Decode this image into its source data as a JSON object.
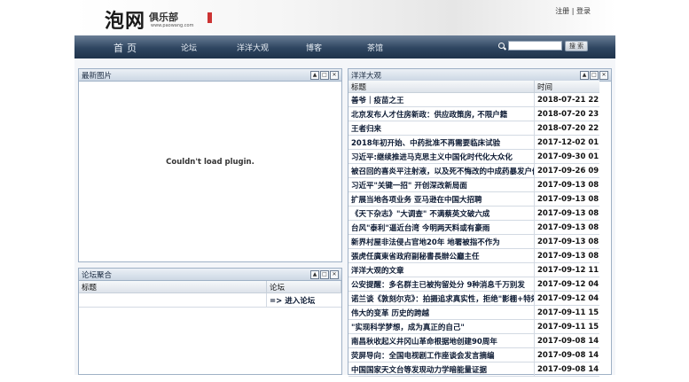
{
  "header": {
    "logo_main": "泡网",
    "logo_sub": "俱乐部",
    "logo_url": "www.paowang.com",
    "link_register": "注册",
    "link_sep": "|",
    "link_login": "登录"
  },
  "nav": {
    "items": [
      "首页",
      "论坛",
      "洋洋大观",
      "博客",
      "茶馆"
    ],
    "search_placeholder": "",
    "search_button": "搜 索"
  },
  "panels": {
    "latest_images": {
      "title": "最新图片",
      "plugin_message": "Couldn't load plugin."
    },
    "forum_aggregate": {
      "title": "论坛聚合",
      "col_title": "标题",
      "col_forum": "论坛",
      "link_enter": "=> 进入论坛"
    },
    "yangyang": {
      "title": "洋洋大观",
      "col_title": "标题",
      "col_time": "时间",
      "rows": [
        {
          "title": "善爷｜疫苗之王",
          "time": "2018-07-21 22:49"
        },
        {
          "title": "北京发布人才住房新政：供应政策房, 不限户籍",
          "time": "2018-07-20 23:13"
        },
        {
          "title": "王者归来",
          "time": "2018-07-20 22:59"
        },
        {
          "title": "2018年初开始、中药批准不再需要临床试验",
          "time": "2017-12-02 01:21"
        },
        {
          "title": "习近平:继续推进马克思主义中国化时代化大众化",
          "time": "2017-09-30 01:57"
        },
        {
          "title": "被召回的喜炎平注射液，以及死不悔改的中成药暴发户们",
          "time": "2017-09-26 09:53"
        },
        {
          "title": "习近平\"关键一招\" 开创深改新局面",
          "time": "2017-09-13 08:26"
        },
        {
          "title": "扩展当地各项业务 亚马逊在中国大招聘",
          "time": "2017-09-13 08:25"
        },
        {
          "title": "《天下杂志》\"大调查\" 不满蔡英文破六成",
          "time": "2017-09-13 08:23"
        },
        {
          "title": "台风\"泰利\"逼近台湾 今明两天料或有豪雨",
          "time": "2017-09-13 08:20"
        },
        {
          "title": "新界村屋非法侵占官地20年 地署被指不作为",
          "time": "2017-09-13 08:19"
        },
        {
          "title": "張虎任廣東省政府副秘書長辦公廳主任",
          "time": "2017-09-13 08:17"
        },
        {
          "title": "洋洋大观的文章",
          "time": "2017-09-12 11:30"
        },
        {
          "title": "公安提醒：多名群主已被拘留处分 9种消息千万别发",
          "time": "2017-09-12 04:40"
        },
        {
          "title": "诺兰谈《敦刻尔克》：拍摄追求真实性，拒绝\"影棚+特效\"",
          "time": "2017-09-12 04:38"
        },
        {
          "title": "伟大的变革 历史的跨越",
          "time": "2017-09-11 15:09"
        },
        {
          "title": "\"实现科学梦想，成为真正的自己\"",
          "time": "2017-09-11 15:06"
        },
        {
          "title": "南昌秋收起义井冈山革命根据地创建90周年",
          "time": "2017-09-08 14:05"
        },
        {
          "title": "荧屏导向：全国电视剧工作座谈会发言摘编",
          "time": "2017-09-08 14:01"
        },
        {
          "title": "中国国家天文台等发现动力学暗能量证据",
          "time": "2017-09-08 14:00"
        }
      ]
    }
  }
}
